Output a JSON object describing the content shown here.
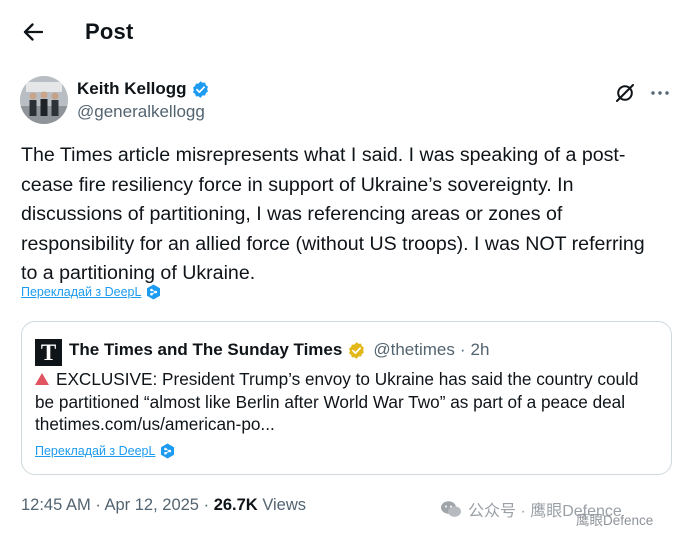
{
  "header": {
    "title": "Post",
    "back_icon": "arrow-left-icon"
  },
  "author": {
    "name": "Keith Kellogg",
    "handle": "@generalkellogg",
    "verified_color": "#1d9bf0"
  },
  "actions": {
    "grok_icon": "grok-icon",
    "more_icon": "more-horizontal-icon"
  },
  "post": {
    "lines": [
      "The Times article misrepresents what I said. I was speaking of a post-",
      "cease fire resiliency force in support of Ukraine’s sovereignty. In",
      "discussions of partitioning, I was referencing areas or zones of",
      "responsibility for an allied force (without US troops). I was NOT referring",
      "to a partitioning of Ukraine."
    ],
    "translate_label": "Перекладай з DeepL"
  },
  "quote": {
    "logo_letter": "T",
    "name": "The Times and The Sunday Times",
    "verified_color": "#e2b719",
    "handle": "@thetimes",
    "separator": "·",
    "time": "2h",
    "lines": [
      "EXCLUSIVE: President Trump’s envoy to Ukraine has said the country could",
      "be partitioned “almost like Berlin after World War Two” as part of a peace deal",
      "thetimes.com/us/american-po..."
    ],
    "translate_label": "Перекладай з DeepL"
  },
  "meta": {
    "time": "12:45 AM",
    "separator": "·",
    "date": "Apr 12, 2025",
    "views_count": "26.7K",
    "views_label": "Views"
  },
  "watermark": {
    "text": "公众号 · 鹰眼Defence",
    "sub": "鹰眼Defence"
  }
}
